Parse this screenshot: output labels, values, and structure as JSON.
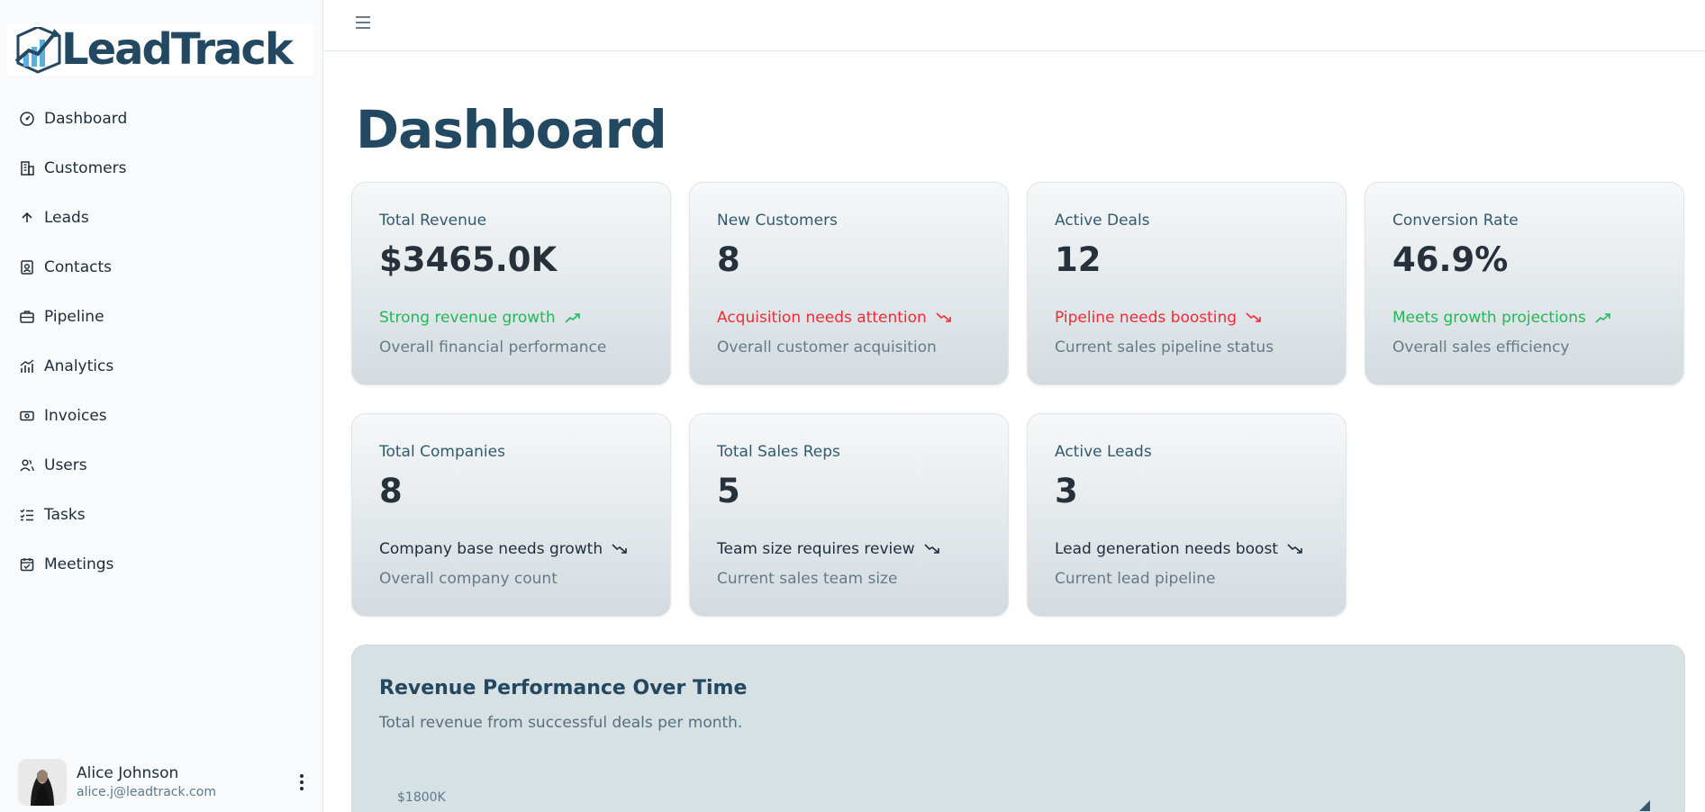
{
  "app": {
    "name": "LeadTrack"
  },
  "sidebar": {
    "items": [
      {
        "label": "Dashboard",
        "icon": "gauge-icon"
      },
      {
        "label": "Customers",
        "icon": "building-icon"
      },
      {
        "label": "Leads",
        "icon": "arrow-up-icon"
      },
      {
        "label": "Contacts",
        "icon": "contact-card-icon"
      },
      {
        "label": "Pipeline",
        "icon": "briefcase-icon"
      },
      {
        "label": "Analytics",
        "icon": "chart-icon"
      },
      {
        "label": "Invoices",
        "icon": "banknote-icon"
      },
      {
        "label": "Users",
        "icon": "users-icon"
      },
      {
        "label": "Tasks",
        "icon": "checklist-icon"
      },
      {
        "label": "Meetings",
        "icon": "calendar-check-icon"
      }
    ]
  },
  "user": {
    "name": "Alice Johnson",
    "email": "alice.j@leadtrack.com"
  },
  "page": {
    "title": "Dashboard"
  },
  "cards": [
    {
      "title": "Total Revenue",
      "value": "$3465.0K",
      "trend": "Strong revenue growth",
      "trend_dir": "up",
      "trend_color": "#21b85a",
      "desc": "Overall financial performance"
    },
    {
      "title": "New Customers",
      "value": "8",
      "trend": "Acquisition needs attention",
      "trend_dir": "down",
      "trend_color": "#ef2c35",
      "desc": "Overall customer acquisition"
    },
    {
      "title": "Active Deals",
      "value": "12",
      "trend": "Pipeline needs boosting",
      "trend_dir": "down",
      "trend_color": "#ef2c35",
      "desc": "Current sales pipeline status"
    },
    {
      "title": "Conversion Rate",
      "value": "46.9%",
      "trend": "Meets growth projections",
      "trend_dir": "up",
      "trend_color": "#21b85a",
      "desc": "Overall sales efficiency"
    },
    {
      "title": "Total Companies",
      "value": "8",
      "trend": "Company base needs growth",
      "trend_dir": "down",
      "trend_color": "#1f2d3a",
      "desc": "Overall company count"
    },
    {
      "title": "Total Sales Reps",
      "value": "5",
      "trend": "Team size requires review",
      "trend_dir": "down",
      "trend_color": "#1f2d3a",
      "desc": "Current sales team size"
    },
    {
      "title": "Active Leads",
      "value": "3",
      "trend": "Lead generation needs boost",
      "trend_dir": "down",
      "trend_color": "#1f2d3a",
      "desc": "Current lead pipeline"
    }
  ],
  "revenue_chart": {
    "title": "Revenue Performance Over Time",
    "subtitle": "Total revenue from successful deals per month.",
    "y_tick_top": "$1800K"
  }
}
